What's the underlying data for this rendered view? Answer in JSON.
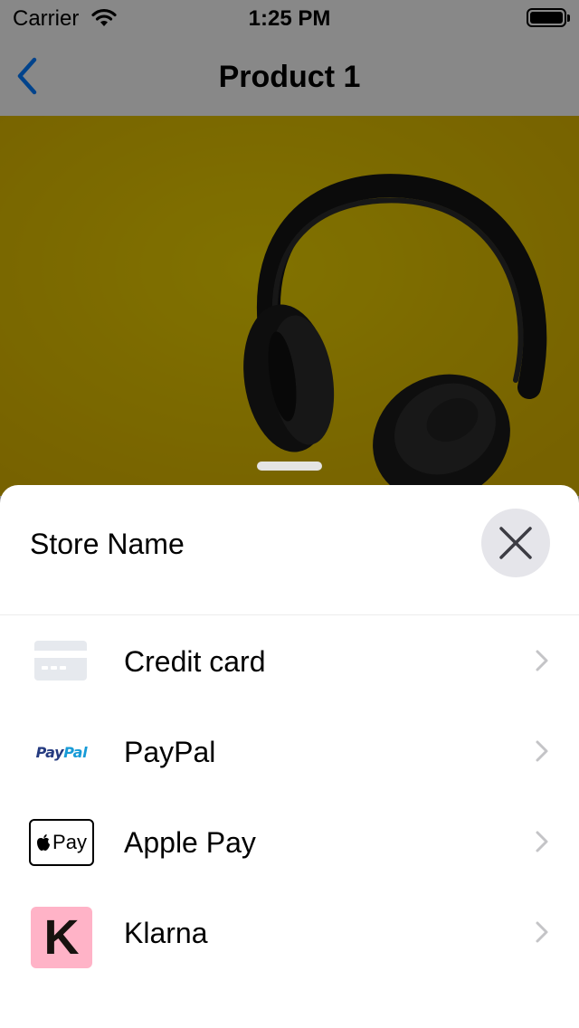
{
  "status_bar": {
    "carrier": "Carrier",
    "time": "1:25 PM"
  },
  "nav": {
    "title": "Product 1"
  },
  "sheet": {
    "store_name": "Store Name",
    "payment_methods": [
      {
        "label": "Credit card",
        "icon": "credit-card-icon"
      },
      {
        "label": "PayPal",
        "icon": "paypal-logo",
        "logo_text_a": "Pay",
        "logo_text_b": "Pal"
      },
      {
        "label": "Apple Pay",
        "icon": "apple-pay-logo",
        "logo_text": "Pay"
      },
      {
        "label": "Klarna",
        "icon": "klarna-logo",
        "logo_text": "K"
      }
    ]
  },
  "colors": {
    "accent": "#007aff",
    "hero_background": "#e3c100",
    "klarna_pink": "#ffb3c7",
    "paypal_dark": "#253b80",
    "paypal_light": "#179bd7"
  }
}
